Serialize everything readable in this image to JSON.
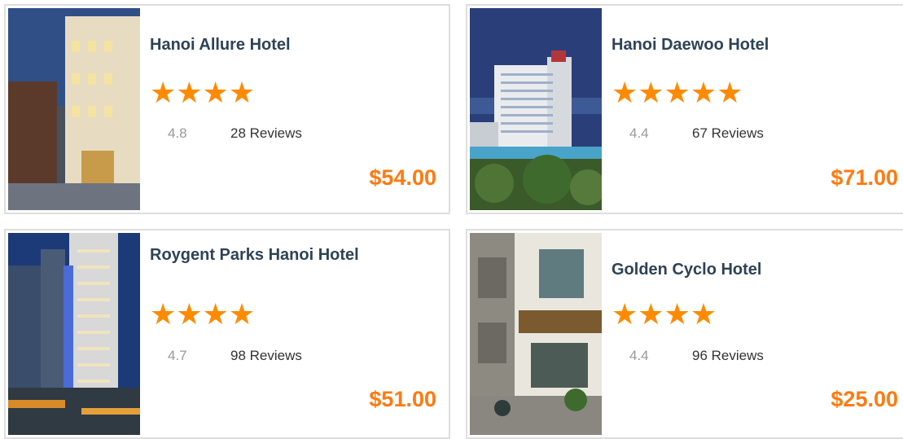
{
  "colors": {
    "star": "#ff8a00",
    "price": "#ff7a10",
    "title": "#2d4356",
    "rating": "#999999",
    "border": "#dedede"
  },
  "hotels": [
    {
      "name": "Hanoi Allure Hotel",
      "stars": "★★★★",
      "star_count": 4,
      "rating": "4.8",
      "reviews": "28 Reviews",
      "price": "$54.00",
      "image": "hotel-photo"
    },
    {
      "name": "Hanoi Daewoo Hotel",
      "stars": "★★★★★",
      "star_count": 5,
      "rating": "4.4",
      "reviews": "67 Reviews",
      "price": "$71.00",
      "image": "hotel-photo"
    },
    {
      "name": "Roygent Parks Hanoi Hotel",
      "stars": "★★★★",
      "star_count": 4,
      "rating": "4.7",
      "reviews": "98 Reviews",
      "price": "$51.00",
      "image": "hotel-photo"
    },
    {
      "name": "Golden Cyclo Hotel",
      "stars": "★★★★",
      "star_count": 4,
      "rating": "4.4",
      "reviews": "96 Reviews",
      "price": "$25.00",
      "image": "hotel-photo"
    }
  ]
}
